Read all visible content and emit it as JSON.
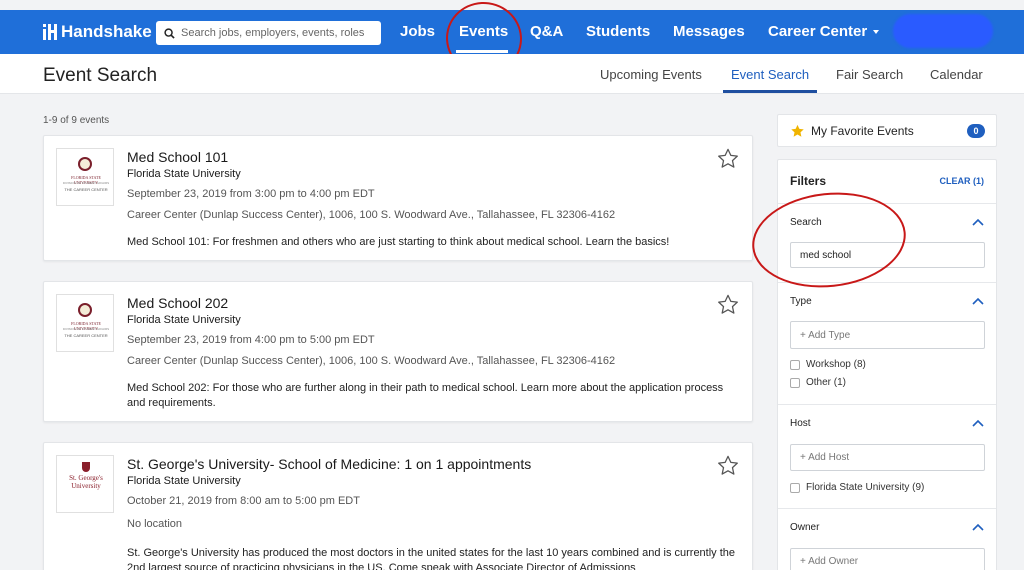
{
  "nav": {
    "brand": "Handshake",
    "search_placeholder": "Search jobs, employers, events, roles",
    "items": [
      "Jobs",
      "Events",
      "Q&A",
      "Students",
      "Messages",
      "Career Center"
    ]
  },
  "subheader": {
    "title": "Event Search",
    "tabs": [
      "Upcoming Events",
      "Event Search",
      "Fair Search",
      "Calendar"
    ],
    "active_tab": "Event Search"
  },
  "results": {
    "count": "1-9 of 9 events",
    "cards": [
      {
        "title": "Med School 101",
        "org": "Florida State University",
        "logo_lines": [
          "FLORIDA STATE UNIVERSITY",
          "DIVISION OF STUDENT AFFAIRS",
          "THE CAREER CENTER"
        ],
        "date": "September 23, 2019 from 3:00 pm to 4:00 pm EDT",
        "location": "Career Center (Dunlap Success Center), 1006, 100 S. Woodward Ave., Tallahassee, FL 32306-4162",
        "desc": "Med School 101: For freshmen and others who are just starting to think about medical school. Learn the basics!"
      },
      {
        "title": "Med School 202",
        "org": "Florida State University",
        "logo_lines": [
          "FLORIDA STATE UNIVERSITY",
          "DIVISION OF STUDENT AFFAIRS",
          "THE CAREER CENTER"
        ],
        "date": "September 23, 2019 from 4:00 pm to 5:00 pm EDT",
        "location": "Career Center (Dunlap Success Center), 1006, 100 S. Woodward Ave., Tallahassee, FL 32306-4162",
        "desc": "Med School 202: For those who are further along in their path to medical school. Learn more about the application process and requirements."
      },
      {
        "title": "St. George's University- School of Medicine: 1 on 1 appointments",
        "org": "Florida State University",
        "logo_lines": [
          "St. George's University"
        ],
        "date": "October 21, 2019 from 8:00 am to 5:00 pm EDT",
        "location": "No location",
        "desc": "St. George's University has produced the most doctors in the united states for the last 10 years combined and is currently the 2nd largest source of practicing physicians in the US. Come speak with Associate Director of Admissions"
      }
    ]
  },
  "favorites": {
    "label": "My Favorite Events",
    "count": "0"
  },
  "filters": {
    "title": "Filters",
    "clear": "CLEAR (1)",
    "search": {
      "label": "Search",
      "value": "med school"
    },
    "type": {
      "label": "Type",
      "placeholder": "+ Add Type",
      "options": [
        "Workshop (8)",
        "Other (1)"
      ]
    },
    "host": {
      "label": "Host",
      "placeholder": "+ Add Host",
      "options": [
        "Florida State University (9)"
      ]
    },
    "owner": {
      "label": "Owner",
      "placeholder": "+ Add Owner"
    }
  },
  "colors": {
    "brand": "#1f6fd9",
    "accent": "#1f5fbf",
    "annotation": "#c81818"
  }
}
